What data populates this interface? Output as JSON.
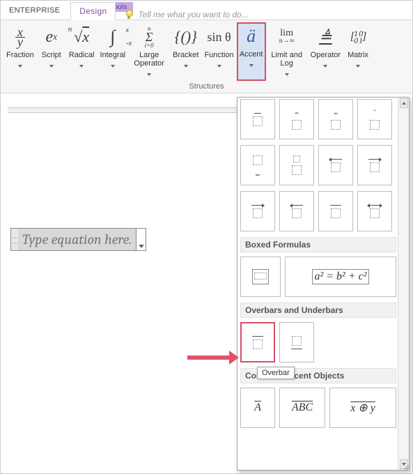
{
  "contextual_tab": "Equation Tools",
  "tabs": {
    "enterprise": "ENTERPRISE",
    "design": "Design"
  },
  "tellme_placeholder": "Tell me what you want to do...",
  "ribbon": {
    "fraction": "Fraction",
    "script": "Script",
    "radical": "Radical",
    "integral": "Integral",
    "large_op": "Large Operator",
    "bracket": "Bracket",
    "function": "Function",
    "accent": "Accent",
    "limitlog": "Limit and Log",
    "operator": "Operator",
    "matrix": "Matrix",
    "group_structures": "Structures"
  },
  "equation_placeholder": "Type equation here.",
  "gallery": {
    "boxed_title": "Boxed Formulas",
    "boxed_sample": "a² = b² + c²",
    "overbars_title": "Overbars and Underbars",
    "overbar_tooltip": "Overbar",
    "common_title": "Common Accent Objects",
    "common_a": "A",
    "common_abc": "ABC",
    "common_xy": "x ⊕ y"
  }
}
